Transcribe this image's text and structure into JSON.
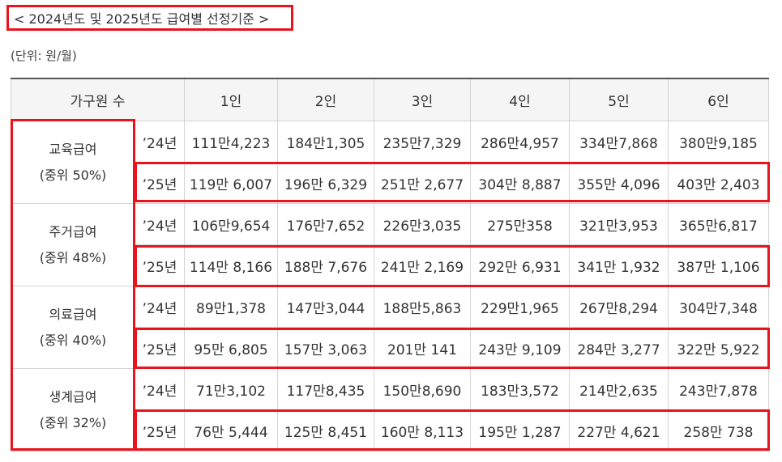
{
  "title": "< 2024년도 및 2025년도 급여별 선정기준 >",
  "unit": "(단위: 원/월)",
  "header": {
    "household": "가구원 수",
    "sizes": [
      "1인",
      "2인",
      "3인",
      "4인",
      "5인",
      "6인"
    ]
  },
  "groups": [
    {
      "name": "교육급여",
      "sub": "(중위 50%)",
      "rows": [
        {
          "year": "’24년",
          "values": [
            "111만4,223",
            "184만1,305",
            "235만7,329",
            "286만4,957",
            "334만7,868",
            "380만9,185"
          ]
        },
        {
          "year": "’25년",
          "values": [
            "119만 6,007",
            "196만 6,329",
            "251만 2,677",
            "304만 8,887",
            "355만 4,096",
            "403만 2,403"
          ]
        }
      ]
    },
    {
      "name": "주거급여",
      "sub": "(중위 48%)",
      "rows": [
        {
          "year": "’24년",
          "values": [
            "106만9,654",
            "176만7,652",
            "226만3,035",
            "275만358",
            "321만3,953",
            "365만6,817"
          ]
        },
        {
          "year": "’25년",
          "values": [
            "114만 8,166",
            "188만 7,676",
            "241만 2,169",
            "292만 6,931",
            "341만 1,932",
            "387만 1,106"
          ]
        }
      ]
    },
    {
      "name": "의료급여",
      "sub": "(중위 40%)",
      "rows": [
        {
          "year": "’24년",
          "values": [
            "89만1,378",
            "147만3,044",
            "188만5,863",
            "229만1,965",
            "267만8,294",
            "304만7,348"
          ]
        },
        {
          "year": "’25년",
          "values": [
            "95만 6,805",
            "157만 3,063",
            "201만 141",
            "243만 9,109",
            "284만 3,277",
            "322만 5,922"
          ]
        }
      ]
    },
    {
      "name": "생계급여",
      "sub": "(중위 32%)",
      "rows": [
        {
          "year": "’24년",
          "values": [
            "71만3,102",
            "117만8,435",
            "150만8,690",
            "183만3,572",
            "214만2,635",
            "243만7,878"
          ]
        },
        {
          "year": "’25년",
          "values": [
            "76만 5,444",
            "125만 8,451",
            "160만 8,113",
            "195만 1,287",
            "227만 4,621",
            "258만 738"
          ]
        }
      ]
    }
  ],
  "highlight_color": "#e8131b"
}
